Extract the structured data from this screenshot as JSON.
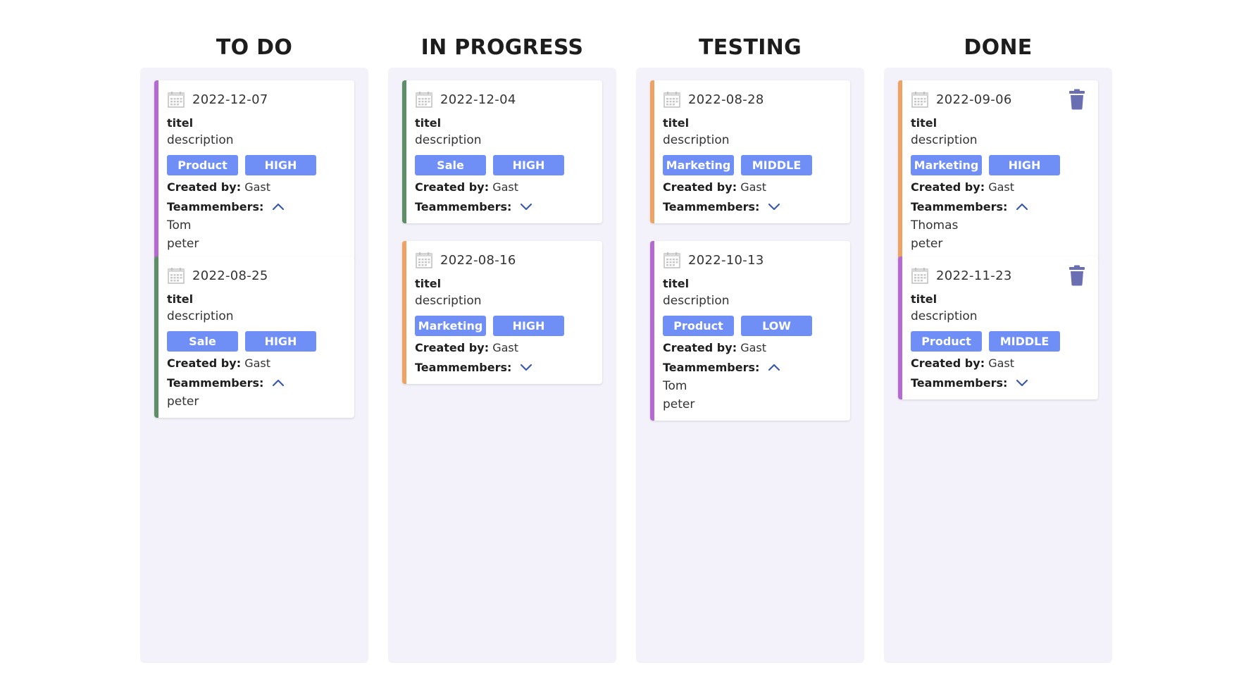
{
  "columns": [
    {
      "title": "TO DO",
      "cards": [
        {
          "date": "2022-12-07",
          "title": "titel",
          "description": "description",
          "tags": [
            "Product",
            "HIGH"
          ],
          "created_label": "Created by:",
          "created_by": "Gast",
          "members_label": "Teammembers:",
          "expanded": true,
          "members": [
            "Tom",
            "peter"
          ],
          "color": "#b56ad3",
          "trash": false
        },
        {
          "date": "2022-08-25",
          "title": "titel",
          "description": "description",
          "tags": [
            "Sale",
            "HIGH"
          ],
          "created_label": "Created by:",
          "created_by": "Gast",
          "members_label": "Teammembers:",
          "expanded": true,
          "members": [
            "peter"
          ],
          "color": "#5c8f65",
          "trash": false
        }
      ]
    },
    {
      "title": "IN PROGRESS",
      "cards": [
        {
          "date": "2022-12-04",
          "title": "titel",
          "description": "description",
          "tags": [
            "Sale",
            "HIGH"
          ],
          "created_label": "Created by:",
          "created_by": "Gast",
          "members_label": "Teammembers:",
          "expanded": false,
          "members": [],
          "color": "#5c8f65",
          "trash": false
        },
        {
          "date": "2022-08-16",
          "title": "titel",
          "description": "description",
          "tags": [
            "Marketing",
            "HIGH"
          ],
          "created_label": "Created by:",
          "created_by": "Gast",
          "members_label": "Teammembers:",
          "expanded": false,
          "members": [],
          "color": "#efa262",
          "trash": false
        }
      ]
    },
    {
      "title": "TESTING",
      "cards": [
        {
          "date": "2022-08-28",
          "title": "titel",
          "description": "description",
          "tags": [
            "Marketing",
            "MIDDLE"
          ],
          "created_label": "Created by:",
          "created_by": "Gast",
          "members_label": "Teammembers:",
          "expanded": false,
          "members": [],
          "color": "#efa262",
          "trash": false
        },
        {
          "date": "2022-10-13",
          "title": "titel",
          "description": "description",
          "tags": [
            "Product",
            "LOW"
          ],
          "created_label": "Created by:",
          "created_by": "Gast",
          "members_label": "Teammembers:",
          "expanded": true,
          "members": [
            "Tom",
            "peter"
          ],
          "color": "#b56ad3",
          "trash": false
        }
      ]
    },
    {
      "title": "DONE",
      "cards": [
        {
          "date": "2022-09-06",
          "title": "titel",
          "description": "description",
          "tags": [
            "Marketing",
            "HIGH"
          ],
          "created_label": "Created by:",
          "created_by": "Gast",
          "members_label": "Teammembers:",
          "expanded": true,
          "members": [
            "Thomas",
            "peter"
          ],
          "color": "#efa262",
          "trash": true
        },
        {
          "date": "2022-11-23",
          "title": "titel",
          "description": "description",
          "tags": [
            "Product",
            "MIDDLE"
          ],
          "created_label": "Created by:",
          "created_by": "Gast",
          "members_label": "Teammembers:",
          "expanded": false,
          "members": [],
          "color": "#b56ad3",
          "trash": true
        }
      ]
    }
  ],
  "icons": {
    "calendar": "calendar-icon",
    "trash": "trash-icon",
    "chevron_up": "chevron-up-icon",
    "chevron_down": "chevron-down-icon"
  },
  "colors": {
    "tag": "#6f8ff6",
    "column_bg": "#f3f2fa",
    "trash": "#6a6fb3",
    "chevron": "#3b5aa6"
  }
}
